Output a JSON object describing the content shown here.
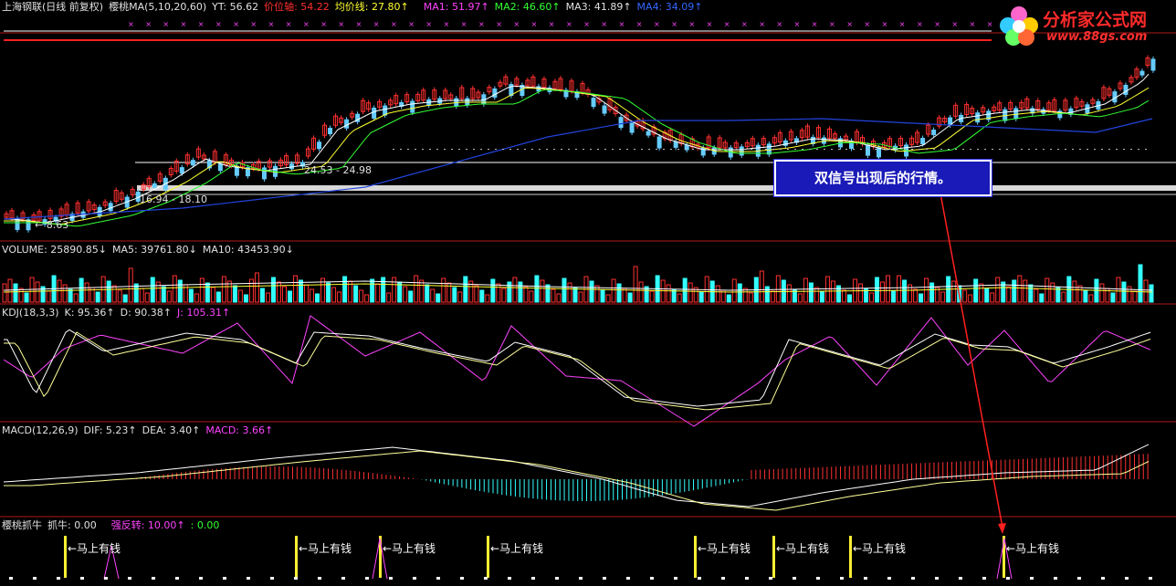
{
  "main_header": {
    "name": "上海钢联(日线 前复权)",
    "indicator": "樱桃MA(5,10,20,60)",
    "yt": "YT: 56.62",
    "price_axis": "价位轴: 54.22",
    "avg_line": "均价线: 27.80↑",
    "ma1": "MA1: 51.97↑",
    "ma2": "MA2: 46.60↑",
    "ma3": "MA3: 41.89↑",
    "ma4": "MA4: 34.09↑"
  },
  "price_labels": {
    "low_label": "← 8.63",
    "range1": "16.94 - 18.10",
    "range2": "24.53 - 24.98",
    "b_marker": "B"
  },
  "volume_header": {
    "volume": "VOLUME: 25890.85↓",
    "ma5": "MA5: 39761.80↓",
    "ma10": "MA10: 43453.90↓"
  },
  "kdj_header": {
    "title": "KDJ(18,3,3)",
    "k": "K: 95.36↑",
    "d": "D: 90.38↑",
    "j": "J: 105.31↑"
  },
  "macd_header": {
    "title": "MACD(12,26,9)",
    "dif": "DIF: 5.23↑",
    "dea": "DEA: 3.40↑",
    "macd": "MACD: 3.66↑"
  },
  "signal_header": {
    "title": "樱桃抓牛",
    "grab": "抓牛: 0.00",
    "reverse": "强反转: 10.00↑",
    "extra": ": 0.00"
  },
  "signal_tag": "←马上有钱",
  "annotation": "双信号出现后的行情。",
  "logo": {
    "title": "分析家公式网",
    "url": "www.88gs.com"
  },
  "colors": {
    "up": "#ff3030",
    "down": "#66ccff",
    "ma1": "#ffffff",
    "ma2": "#ffff33",
    "ma3": "#ff44ff",
    "ma4": "#33ff33",
    "long_ma": "#2244dd",
    "separator": "#b01818"
  }
}
